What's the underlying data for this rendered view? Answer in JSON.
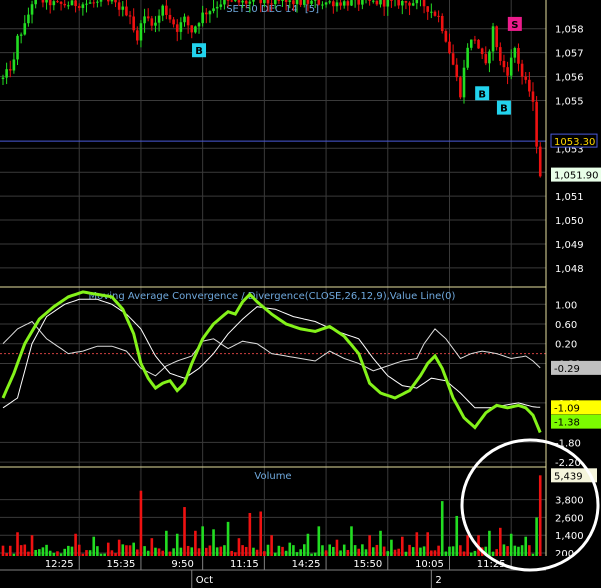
{
  "chart_data": [
    {
      "panel": "price",
      "type": "candlestick",
      "title": "SET50 DEC 14",
      "period_label": "[5]",
      "ylim": [
        1047.2,
        1059.2
      ],
      "yticks": [
        "1,058",
        "1,057",
        "1,056",
        "1,055",
        "1,053",
        "1,052",
        "1,051",
        "1,050",
        "1,049",
        "1,048"
      ],
      "ytick_values": [
        1058,
        1057,
        1056,
        1055,
        1053,
        1052,
        1051,
        1050,
        1049,
        1048
      ],
      "horizontal_line": {
        "value": 1053.3,
        "label": "1053.30",
        "color": "#4a5ad8"
      },
      "last_price": {
        "value": 1051.9,
        "label": "1,051.90"
      },
      "signals": [
        {
          "label": "B",
          "bar": 54,
          "value": 1057.1,
          "color": "#22d3ee"
        },
        {
          "label": "B",
          "bar": 132,
          "value": 1055.3,
          "color": "#22d3ee"
        },
        {
          "label": "B",
          "bar": 138,
          "value": 1054.7,
          "color": "#22d3ee"
        },
        {
          "label": "S",
          "bar": 141,
          "value": 1058.2,
          "color": "#ec1c8c"
        }
      ],
      "anchors": [
        [
          0,
          1055.9
        ],
        [
          3,
          1056.6
        ],
        [
          4,
          1057.6
        ],
        [
          6,
          1058.1
        ],
        [
          8,
          1059.1
        ],
        [
          10,
          1059.2
        ],
        [
          15,
          1059.0
        ],
        [
          30,
          1059.1
        ],
        [
          35,
          1058.6
        ],
        [
          37,
          1057.4
        ],
        [
          38,
          1058.4
        ],
        [
          40,
          1058.4
        ],
        [
          42,
          1058.2
        ],
        [
          44,
          1058.9
        ],
        [
          48,
          1058.0
        ],
        [
          50,
          1058.4
        ],
        [
          52,
          1057.9
        ],
        [
          55,
          1058.6
        ],
        [
          60,
          1059.1
        ],
        [
          100,
          1059.1
        ],
        [
          115,
          1059.1
        ],
        [
          120,
          1058.5
        ],
        [
          122,
          1057.6
        ],
        [
          124,
          1056.5
        ],
        [
          126,
          1055.3
        ],
        [
          128,
          1057.3
        ],
        [
          130,
          1057.6
        ],
        [
          133,
          1056.4
        ],
        [
          135,
          1058.0
        ],
        [
          137,
          1056.6
        ],
        [
          139,
          1056.2
        ],
        [
          141,
          1057.2
        ],
        [
          143,
          1056.0
        ],
        [
          145,
          1055.4
        ],
        [
          146,
          1054.8
        ],
        [
          147,
          1053.2
        ],
        [
          148,
          1051.9
        ]
      ],
      "up_color": "#22dd22",
      "down_color": "#ee1111"
    },
    {
      "panel": "macd",
      "type": "line",
      "title": "Moving Average Convergence / Divergence(CLOSE,26,12,9),Value Line(0)",
      "ylim": [
        -2.3,
        1.35
      ],
      "yticks": [
        "1.00",
        "0.60",
        "0.20",
        "-0.20",
        "-1.00",
        "-1.80",
        "-2.20"
      ],
      "ytick_values": [
        1.0,
        0.6,
        0.2,
        -0.2,
        -1.0,
        -1.8,
        -2.2
      ],
      "zero_line": 0,
      "value_labels": [
        {
          "label": "-0.29",
          "value": -0.29,
          "bg": "#c0c0c0"
        },
        {
          "label": "-1.09",
          "value": -1.09,
          "bg": "#ffff00"
        },
        {
          "label": "-1.38",
          "value": -1.38,
          "bg": "#7cfc00"
        }
      ],
      "series": [
        {
          "role": "macd",
          "color": "#84f21a",
          "anchors": [
            [
              0,
              -0.9
            ],
            [
              3,
              -0.4
            ],
            [
              6,
              0.2
            ],
            [
              10,
              0.7
            ],
            [
              14,
              0.95
            ],
            [
              18,
              1.15
            ],
            [
              22,
              1.25
            ],
            [
              26,
              1.2
            ],
            [
              30,
              1.15
            ],
            [
              33,
              0.9
            ],
            [
              36,
              0.4
            ],
            [
              38,
              -0.2
            ],
            [
              40,
              -0.5
            ],
            [
              42,
              -0.7
            ],
            [
              44,
              -0.6
            ],
            [
              46,
              -0.55
            ],
            [
              48,
              -0.75
            ],
            [
              50,
              -0.6
            ],
            [
              52,
              -0.2
            ],
            [
              55,
              0.3
            ],
            [
              58,
              0.6
            ],
            [
              62,
              0.85
            ],
            [
              64,
              0.8
            ],
            [
              66,
              1.05
            ],
            [
              68,
              1.2
            ],
            [
              70,
              1.05
            ],
            [
              74,
              0.8
            ],
            [
              78,
              0.6
            ],
            [
              82,
              0.5
            ],
            [
              86,
              0.45
            ],
            [
              90,
              0.55
            ],
            [
              94,
              0.35
            ],
            [
              98,
              0.0
            ],
            [
              101,
              -0.6
            ],
            [
              104,
              -0.8
            ],
            [
              108,
              -0.9
            ],
            [
              112,
              -0.75
            ],
            [
              115,
              -0.45
            ],
            [
              117,
              -0.2
            ],
            [
              119,
              -0.05
            ],
            [
              121,
              -0.3
            ],
            [
              124,
              -0.9
            ],
            [
              127,
              -1.3
            ],
            [
              130,
              -1.5
            ],
            [
              133,
              -1.2
            ],
            [
              136,
              -1.05
            ],
            [
              139,
              -1.1
            ],
            [
              142,
              -1.05
            ],
            [
              144,
              -1.1
            ],
            [
              146,
              -1.25
            ],
            [
              148,
              -1.6
            ]
          ]
        },
        {
          "role": "signal",
          "color": "#ffffff",
          "anchors": [
            [
              0,
              -1.1
            ],
            [
              4,
              -0.9
            ],
            [
              8,
              0.2
            ],
            [
              12,
              0.75
            ],
            [
              17,
              1.0
            ],
            [
              21,
              1.1
            ],
            [
              26,
              1.1
            ],
            [
              30,
              1.0
            ],
            [
              34,
              0.8
            ],
            [
              38,
              0.5
            ],
            [
              42,
              -0.05
            ],
            [
              46,
              -0.4
            ],
            [
              50,
              -0.5
            ],
            [
              54,
              -0.3
            ],
            [
              58,
              0.0
            ],
            [
              62,
              0.4
            ],
            [
              66,
              0.7
            ],
            [
              70,
              0.95
            ],
            [
              75,
              0.9
            ],
            [
              80,
              0.75
            ],
            [
              86,
              0.65
            ],
            [
              92,
              0.45
            ],
            [
              98,
              0.3
            ],
            [
              102,
              -0.1
            ],
            [
              106,
              -0.45
            ],
            [
              110,
              -0.65
            ],
            [
              114,
              -0.7
            ],
            [
              118,
              -0.5
            ],
            [
              122,
              -0.55
            ],
            [
              126,
              -0.8
            ],
            [
              130,
              -1.1
            ],
            [
              134,
              -1.1
            ],
            [
              138,
              -1.05
            ],
            [
              142,
              -1.0
            ],
            [
              146,
              -1.08
            ],
            [
              148,
              -1.09
            ]
          ]
        },
        {
          "role": "histogram",
          "color": "#dddddd",
          "anchors": [
            [
              0,
              0.2
            ],
            [
              4,
              0.5
            ],
            [
              8,
              0.65
            ],
            [
              12,
              0.3
            ],
            [
              15,
              0.15
            ],
            [
              18,
              0.0
            ],
            [
              22,
              0.05
            ],
            [
              26,
              0.15
            ],
            [
              30,
              0.15
            ],
            [
              34,
              0.05
            ],
            [
              38,
              -0.3
            ],
            [
              42,
              -0.45
            ],
            [
              45,
              -0.25
            ],
            [
              48,
              -0.15
            ],
            [
              52,
              -0.05
            ],
            [
              55,
              0.25
            ],
            [
              58,
              0.3
            ],
            [
              62,
              0.1
            ],
            [
              66,
              0.25
            ],
            [
              70,
              0.2
            ],
            [
              74,
              0.0
            ],
            [
              78,
              -0.05
            ],
            [
              82,
              -0.1
            ],
            [
              86,
              -0.15
            ],
            [
              90,
              0.05
            ],
            [
              94,
              -0.1
            ],
            [
              98,
              -0.2
            ],
            [
              102,
              -0.35
            ],
            [
              106,
              -0.25
            ],
            [
              110,
              -0.15
            ],
            [
              114,
              -0.1
            ],
            [
              116,
              0.2
            ],
            [
              119,
              0.5
            ],
            [
              122,
              0.3
            ],
            [
              126,
              -0.1
            ],
            [
              129,
              0.0
            ],
            [
              132,
              0.05
            ],
            [
              136,
              0.0
            ],
            [
              140,
              -0.1
            ],
            [
              144,
              -0.05
            ],
            [
              146,
              -0.15
            ],
            [
              148,
              -0.29
            ]
          ]
        }
      ]
    },
    {
      "panel": "volume",
      "type": "bar",
      "title": "Volume",
      "ylim": [
        0,
        6000
      ],
      "yticks": [
        "3,800",
        "2,600",
        "1,400",
        "200"
      ],
      "ytick_values": [
        3800,
        2600,
        1400,
        200
      ],
      "last_value": {
        "label": "5,439",
        "value": 5439
      },
      "spikes": [
        [
          4,
          1600
        ],
        [
          8,
          1400
        ],
        [
          20,
          1500
        ],
        [
          25,
          1300
        ],
        [
          29,
          900
        ],
        [
          32,
          1100
        ],
        [
          36,
          900
        ],
        [
          38,
          4400
        ],
        [
          41,
          1200
        ],
        [
          45,
          1700
        ],
        [
          48,
          1500
        ],
        [
          50,
          3300
        ],
        [
          53,
          1700
        ],
        [
          55,
          2000
        ],
        [
          58,
          1800
        ],
        [
          62,
          2300
        ],
        [
          65,
          1200
        ],
        [
          68,
          2900
        ],
        [
          71,
          3000
        ],
        [
          74,
          1400
        ],
        [
          79,
          900
        ],
        [
          84,
          1500
        ],
        [
          87,
          2000
        ],
        [
          92,
          1100
        ],
        [
          96,
          2000
        ],
        [
          101,
          1400
        ],
        [
          104,
          1700
        ],
        [
          107,
          1100
        ],
        [
          110,
          1300
        ],
        [
          114,
          1600
        ],
        [
          117,
          1600
        ],
        [
          121,
          3700
        ],
        [
          125,
          2700
        ],
        [
          128,
          1400
        ],
        [
          131,
          1400
        ],
        [
          134,
          1700
        ],
        [
          137,
          1900
        ],
        [
          140,
          1500
        ],
        [
          144,
          1300
        ],
        [
          147,
          2600
        ],
        [
          148,
          5439
        ]
      ],
      "up_color": "#22dd22",
      "down_color": "#ee1111"
    }
  ],
  "x_axis": {
    "time_labels": [
      {
        "label": "12:25",
        "bar": 21
      },
      {
        "label": "15:35",
        "bar": 38
      },
      {
        "label": "9:50",
        "bar": 55
      },
      {
        "label": "11:15",
        "bar": 72
      },
      {
        "label": "14:25",
        "bar": 89
      },
      {
        "label": "15:50",
        "bar": 106
      },
      {
        "label": "10:05",
        "bar": 123
      },
      {
        "label": "11:25",
        "bar": 140
      }
    ],
    "date_labels": [
      {
        "label": "Oct",
        "bar": 52
      },
      {
        "label": "2",
        "bar": 118
      }
    ]
  },
  "colors": {
    "background": "#000000",
    "grid": "#3a3a3a",
    "panel_border": "#e6e0a0",
    "axis_text": "#ffffff",
    "title_text": "#6fa8dc",
    "annotation_circle": "#ffffff"
  }
}
